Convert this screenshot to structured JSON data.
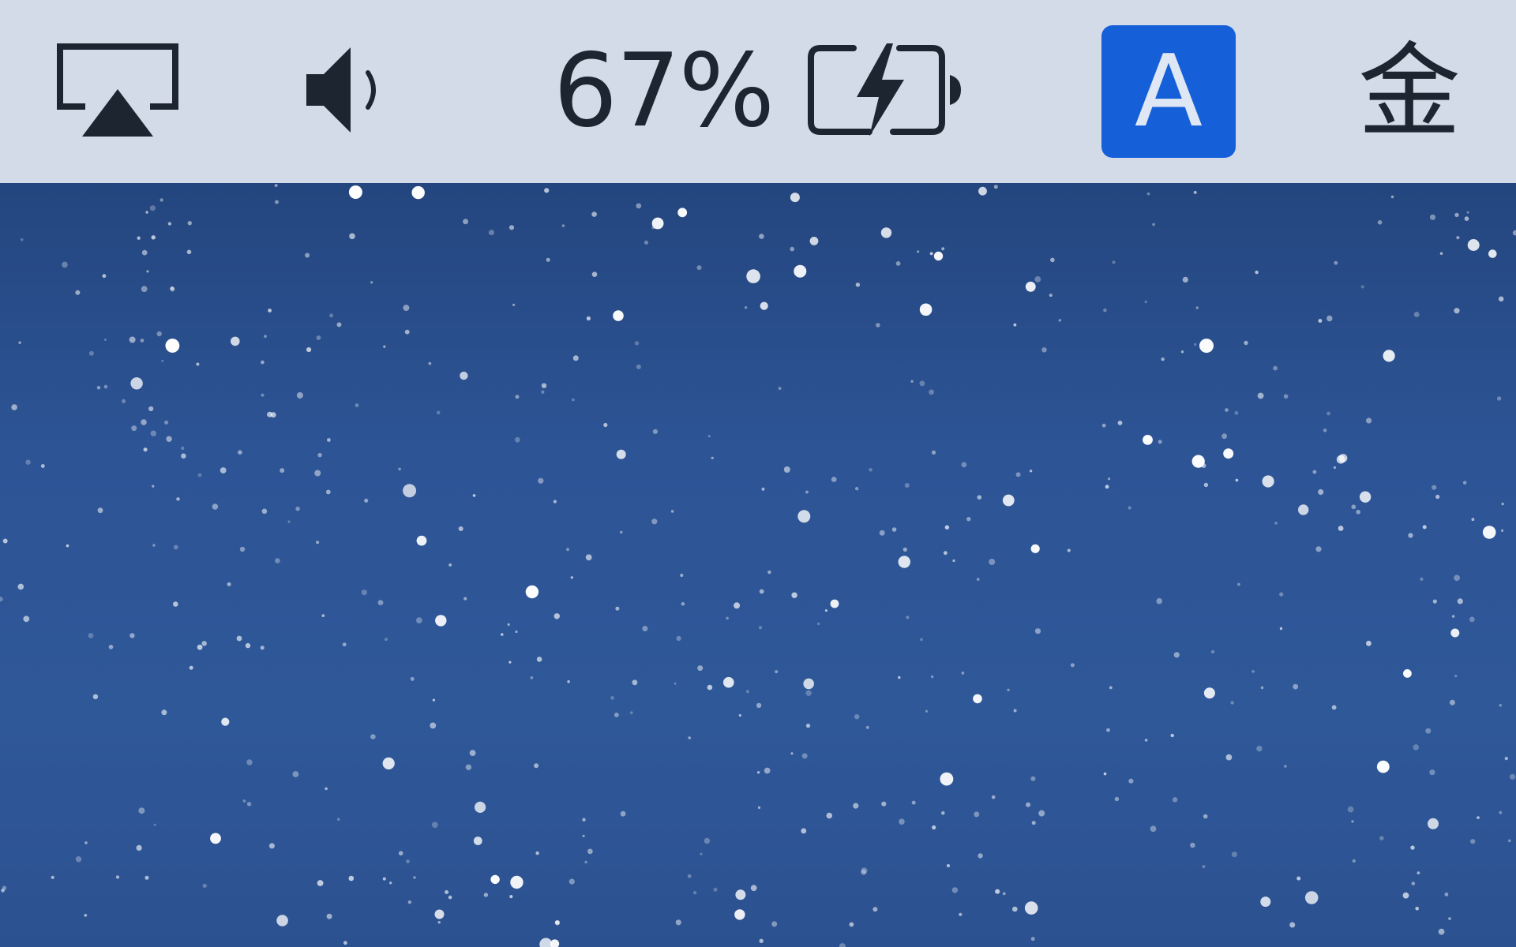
{
  "menubar": {
    "airplay_icon": "airplay-icon",
    "volume_icon": "speaker-volume-icon",
    "battery": {
      "percent_text": "67%",
      "level": 0.67,
      "charging": true,
      "icon": "battery-charging-icon"
    },
    "input_source": {
      "label": "A"
    },
    "clock": {
      "text": "金"
    }
  },
  "desktop": {
    "wallpaper": "starry-night-blue"
  },
  "colors": {
    "menubar_bg": "#d3dae8",
    "icon_fg": "#1d2530",
    "input_badge_bg": "#1560d8",
    "wallpaper_top": "#24467f",
    "wallpaper_bottom": "#2c5190"
  }
}
